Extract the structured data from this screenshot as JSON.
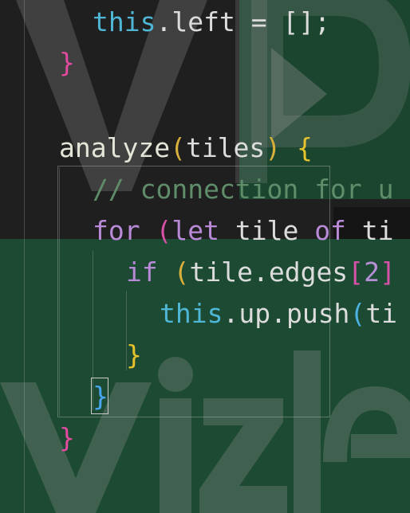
{
  "code_lines": [
    {
      "tokens": [
        "this",
        ".left = [];"
      ]
    },
    {
      "tokens": [
        "}"
      ]
    },
    {
      "tokens": []
    },
    {
      "tokens": [
        "analyze",
        "(",
        "tiles",
        ")",
        " {"
      ]
    },
    {
      "tokens": [
        "// connection for u"
      ]
    },
    {
      "tokens": [
        "for",
        " (",
        "let",
        " tile ",
        "of",
        " ti"
      ]
    },
    {
      "tokens": [
        "if",
        " (",
        "tile.edges",
        "[",
        "2",
        "]"
      ]
    },
    {
      "tokens": [
        "this",
        ".up.push",
        "(",
        "ti"
      ]
    },
    {
      "tokens": [
        "}"
      ]
    },
    {
      "tokens": [
        "}"
      ]
    },
    {
      "tokens": [
        "}"
      ]
    },
    {
      "tokens": [
        "",
        "",
        ""
      ]
    }
  ],
  "watermark": {
    "text_top": "V P",
    "text_bottom": "vizle"
  },
  "colors": {
    "background": "#1f1f1f",
    "green_overlay": "#1c4a33",
    "keyword": "#b98ad8",
    "this": "#4fb6d6",
    "comment": "#5f8d6a"
  }
}
